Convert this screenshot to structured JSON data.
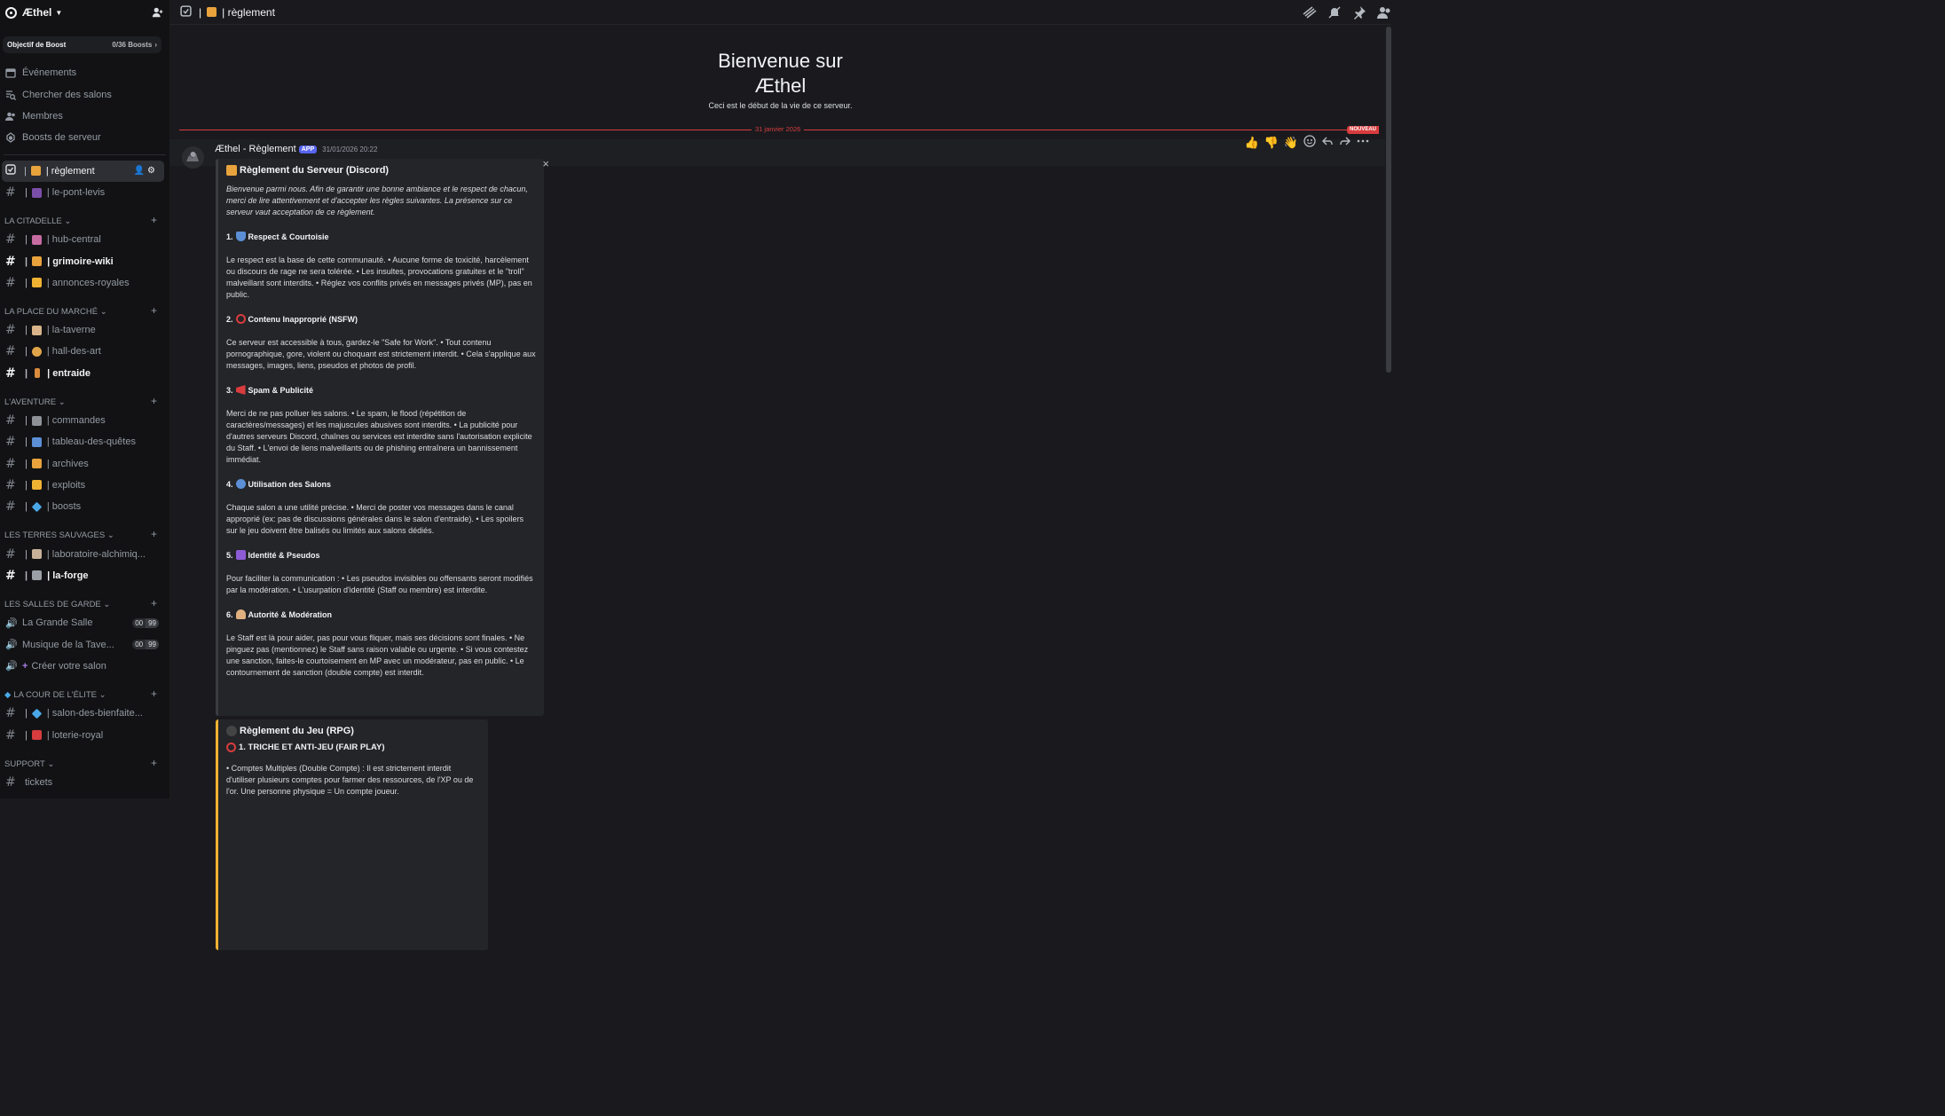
{
  "server": {
    "name": "Æthel"
  },
  "boost": {
    "label": "Objectif de Boost",
    "count": "0/36 Boosts"
  },
  "topnav": [
    {
      "label": "Événements",
      "icon": "calendar-icon"
    },
    {
      "label": "Chercher des salons",
      "icon": "search-channels-icon"
    },
    {
      "label": "Membres",
      "icon": "members-icon"
    },
    {
      "label": "Boosts de serveur",
      "icon": "boost-icon"
    }
  ],
  "pinned_channels": [
    {
      "label": "| règlement",
      "emoji": "scroll-icon",
      "active": true
    },
    {
      "label": "| le-pont-levis",
      "emoji": "bridge-icon"
    }
  ],
  "categories": {
    "citadelle": {
      "name": "LA CITADELLE",
      "channels": [
        "| hub-central",
        "| grimoire-wiki",
        "| annonces-royales"
      ]
    },
    "marche": {
      "name": "LA PLACE DU MARCHÉ",
      "channels": [
        "| la-taverne",
        "| hall-des-art",
        "| entraide"
      ]
    },
    "aventure": {
      "name": "L'AVENTURE",
      "channels": [
        "| commandes",
        "| tableau-des-quêtes",
        "| archives",
        "| exploits",
        "| boosts"
      ]
    },
    "terres": {
      "name": "LES TERRES SAUVAGES",
      "channels": [
        "| laboratoire-alchimiq...",
        "| la-forge"
      ]
    },
    "garde": {
      "name": "LES SALLES DE GARDE",
      "voice": [
        {
          "label": "La Grande Salle",
          "a": "00",
          "b": "99"
        },
        {
          "label": "Musique de la Tave...",
          "a": "00",
          "b": "99"
        }
      ],
      "create": "Créer votre salon"
    },
    "elite": {
      "name": "LA COUR DE L'ÉLITE",
      "channels": [
        "| salon-des-bienfaite...",
        "| loterie-royal"
      ]
    },
    "support": {
      "name": "SUPPORT",
      "channels": [
        "tickets"
      ]
    }
  },
  "topbar": {
    "channel": "| règlement"
  },
  "welcome": {
    "title_line1": "Bienvenue sur",
    "title_line2": "Æthel",
    "subtitle": "Ceci est le début de la vie de ce serveur."
  },
  "divider": {
    "date": "31 janvier 2026",
    "new": "NOUVEAU"
  },
  "message": {
    "author": "Æthel - Règlement",
    "tag": "APP",
    "timestamp": "31/01/2026 20:22",
    "reactions": [
      "👍",
      "👎",
      "👋"
    ]
  },
  "embed1": {
    "title": "Règlement du Serveur (Discord)",
    "intro": "Bienvenue parmi nous. Afin de garantir une bonne ambiance et le respect de chacun, merci de lire attentivement et d'accepter les règles suivantes. La présence sur ce serveur vaut acceptation de ce règlement.",
    "rules": [
      {
        "num": "1.",
        "title": "Respect & Courtoisie",
        "body": "Le respect est la base de cette communauté. • Aucune forme de toxicité, harcèlement ou discours de rage ne sera tolérée. • Les insultes, provocations gratuites et le \"troll\" malveillant sont interdits. • Réglez vos conflits privés en messages privés (MP), pas en public."
      },
      {
        "num": "2.",
        "title": "Contenu Inapproprié (NSFW)",
        "body": "Ce serveur est accessible à tous, gardez-le \"Safe for Work\". • Tout contenu pornographique, gore, violent ou choquant est strictement interdit. • Cela s'applique aux messages, images, liens, pseudos et photos de profil."
      },
      {
        "num": "3.",
        "title": "Spam & Publicité",
        "body": "Merci de ne pas polluer les salons. • Le spam, le flood (répétition de caractères/messages) et les majuscules abusives sont interdits. • La publicité pour d'autres serveurs Discord, chaînes ou services est interdite sans l'autorisation explicite du Staff. • L'envoi de liens malveillants ou de phishing entraînera un bannissement immédiat."
      },
      {
        "num": "4.",
        "title": "Utilisation des Salons",
        "body": "Chaque salon a une utilité précise. • Merci de poster vos messages dans le canal approprié (ex: pas de discussions générales dans le salon d'entraide). • Les spoilers sur le jeu doivent être balisés ou limités aux salons dédiés."
      },
      {
        "num": "5.",
        "title": "Identité & Pseudos",
        "body": "Pour faciliter la communication : • Les pseudos invisibles ou offensants seront modifiés par la modération. • L'usurpation d'identité (Staff ou membre) est interdite."
      },
      {
        "num": "6.",
        "title": "Autorité & Modération",
        "body": "Le Staff est là pour aider, pas pour vous fliquer, mais ses décisions sont finales. • Ne pinguez pas (mentionnez) le Staff sans raison valable ou urgente. • Si vous contestez une sanction, faites-le courtoisement en MP avec un modérateur, pas en public. • Le contournement de sanction (double compte) est interdit."
      }
    ]
  },
  "embed2": {
    "title": "Règlement du Jeu (RPG)",
    "subtitle": "1. TRICHE ET ANTI-JEU (FAIR PLAY)",
    "body": "• Comptes Multiples (Double Compte) : Il est strictement interdit d'utiliser plusieurs comptes pour farmer des ressources, de l'XP ou de l'or. Une personne physique = Un compte joueur."
  }
}
